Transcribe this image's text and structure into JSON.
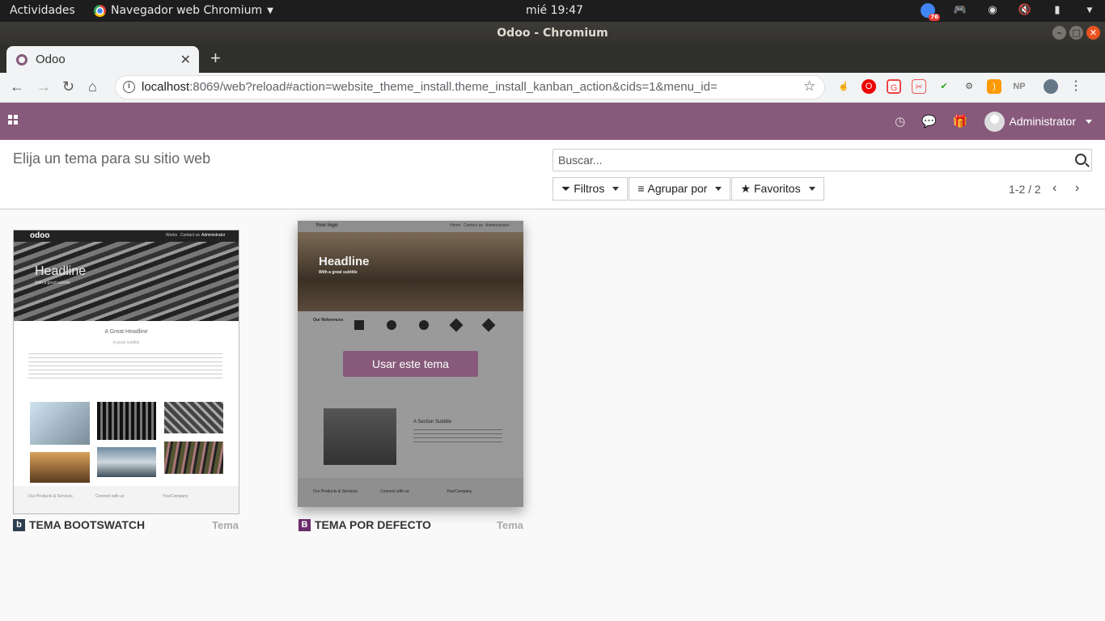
{
  "os": {
    "activities": "Actividades",
    "app_name": "Navegador web Chromium",
    "clock": "mié 19:47",
    "tray_badge": "76"
  },
  "window": {
    "title": "Odoo - Chromium"
  },
  "browser": {
    "tab_title": "Odoo",
    "url_host": "localhost",
    "url_rest": ":8069/web?reload#action=website_theme_install.theme_install_kanban_action&cids=1&menu_id="
  },
  "odoo": {
    "user": "Administrator",
    "page_title": "Elija un tema para su sitio web",
    "search_placeholder": "Buscar...",
    "filters_label": "Filtros",
    "group_label": "Agrupar por",
    "fav_label": "Favoritos",
    "pager": "1-2 / 2",
    "accent": "#875a7b"
  },
  "themes": [
    {
      "name": "TEMA BOOTSWATCH",
      "tag": "Tema",
      "preview": {
        "logo": "odoo",
        "nav": [
          "Works",
          "Contact us",
          "Administrator"
        ],
        "headline": "Headline",
        "subtitle": "With a good subtitle",
        "section_title": "A Great Headline",
        "section_sub": "A good subtitle",
        "footer": [
          "Our Products & Services",
          "Connect with us",
          "YourCompany"
        ]
      }
    },
    {
      "name": "TEMA POR DEFECTO",
      "tag": "Tema",
      "action": "Usar este tema",
      "preview": {
        "logo": "Your logo",
        "nav": [
          "Home",
          "Contact us",
          "Administrator"
        ],
        "headline": "Headline",
        "subtitle": "With a great subtitle",
        "refs": "Our References",
        "section_title": "A Section Subtitle",
        "footer": [
          "Our Products & Services",
          "Connect with us",
          "YourCompany"
        ]
      }
    }
  ]
}
